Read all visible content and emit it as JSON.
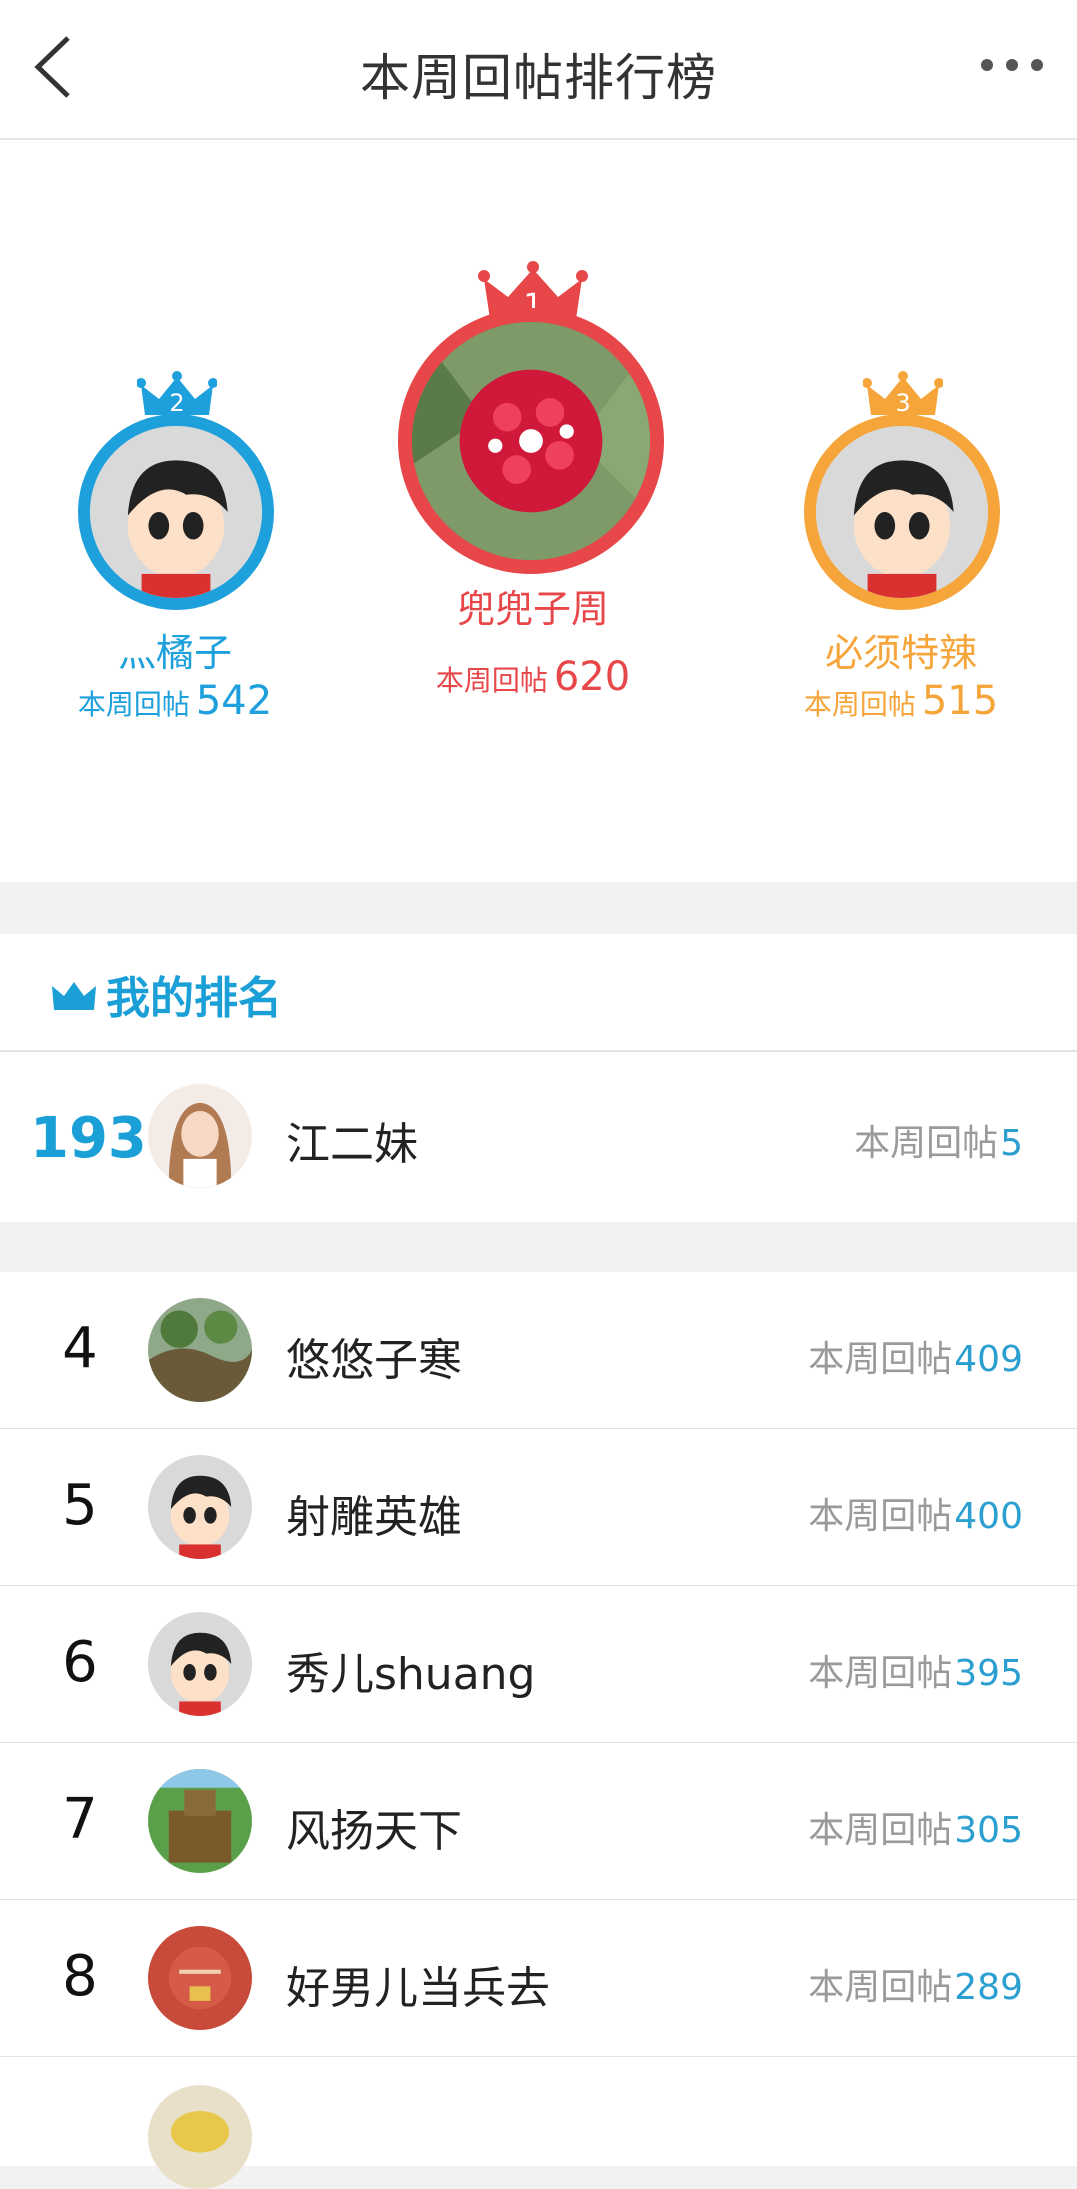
{
  "header": {
    "title": "本周回帖排行榜",
    "back_icon": "chevron-left-icon",
    "more_icon": "more-dots-icon"
  },
  "podium": [
    {
      "rank": "1",
      "name": "兜兜子周",
      "stat_label": "本周回帖",
      "count": "620",
      "color": "#e8474a"
    },
    {
      "rank": "2",
      "name": "灬橘子",
      "stat_label": "本周回帖",
      "count": "542",
      "color": "#1ea0dc"
    },
    {
      "rank": "3",
      "name": "必须特辣",
      "stat_label": "本周回帖",
      "count": "515",
      "color": "#f5a53a"
    }
  ],
  "my_rank": {
    "heading": "我的排名",
    "rank": "193",
    "name": "江二妹",
    "stat_label": "本周回帖",
    "count": "5"
  },
  "list": [
    {
      "rank": "4",
      "name": "悠悠子寒",
      "stat_label": "本周回帖",
      "count": "409"
    },
    {
      "rank": "5",
      "name": "射雕英雄",
      "stat_label": "本周回帖",
      "count": "400"
    },
    {
      "rank": "6",
      "name": "秀儿shuang",
      "stat_label": "本周回帖",
      "count": "395"
    },
    {
      "rank": "7",
      "name": "风扬天下",
      "stat_label": "本周回帖",
      "count": "305"
    },
    {
      "rank": "8",
      "name": "好男儿当兵去",
      "stat_label": "本周回帖",
      "count": "289"
    }
  ],
  "colors": {
    "accent": "#1a9fd6",
    "gold": "#e8474a",
    "silver": "#1ea0dc",
    "bronze": "#f5a53a"
  }
}
